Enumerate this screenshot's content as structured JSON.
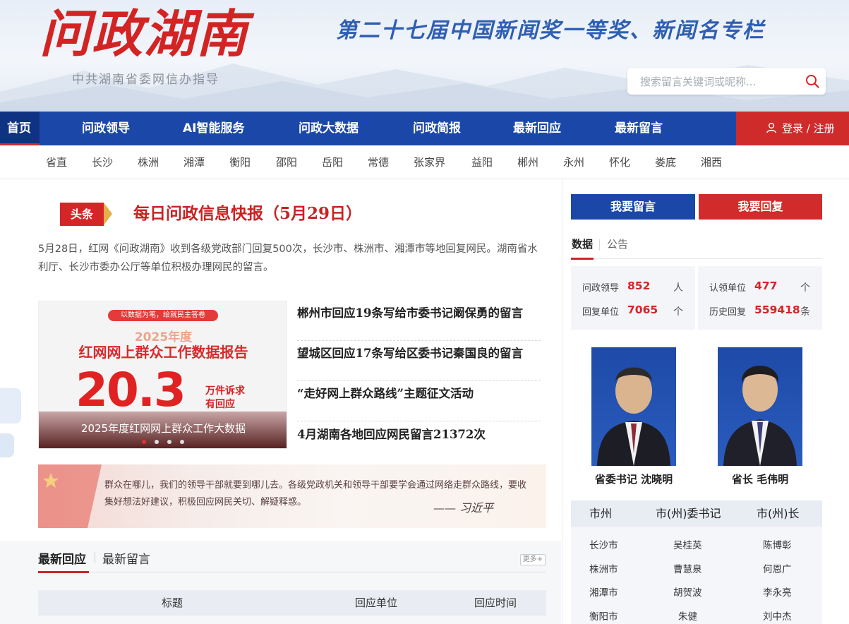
{
  "header": {
    "logo_text": "问政湖南",
    "logo_sub": "中共湖南省委网信办指导",
    "slogan": "第二十七届中国新闻奖一等奖、新闻名专栏",
    "search_placeholder": "搜索留言关键词或昵称..."
  },
  "nav": {
    "items": [
      "首页",
      "问政领导",
      "AI智能服务",
      "问政大数据",
      "问政简报",
      "最新回应",
      "最新留言"
    ],
    "login": "登录 / 注册"
  },
  "cities": [
    "省直",
    "长沙",
    "株洲",
    "湘潭",
    "衡阳",
    "邵阳",
    "岳阳",
    "常德",
    "张家界",
    "益阳",
    "郴州",
    "永州",
    "怀化",
    "娄底",
    "湘西"
  ],
  "headline": {
    "tag": "头条",
    "title": "每日问政信息快报（5月29日）",
    "summary": "5月28日，红网《问政湖南》收到各级党政部门回复500次，长沙市、株洲市、湘潭市等地回复网民。湖南省水利厅、长沙市委办公厅等单位积极办理网民的留言。"
  },
  "carousel": {
    "chip": "以数据为笔，绘就民主答卷",
    "year": "2025年度",
    "title": "红网网上群众工作数据报告",
    "number": "20.3",
    "unit1": "万件诉求",
    "unit2": "有回应",
    "caption": "2025年度红网网上群众工作大数据",
    "slide_count": 4,
    "active_slide": 1
  },
  "news": [
    "郴州市回应19条写给市委书记阚保勇的留言",
    "望城区回应17条写给区委书记秦国良的留言",
    "“走好网上群众路线”主题征文活动",
    "4月湖南各地回应网民留言21372次"
  ],
  "quote": {
    "text": "群众在哪儿，我们的领导干部就要到哪儿去。各级党政机关和领导干部要学会通过网络走群众路线，要收集好想法好建议，积极回应网民关切、解疑释惑。",
    "signature": "—— 习近平"
  },
  "tabs": {
    "items": [
      "最新回应",
      "最新留言"
    ],
    "more": "更多+",
    "columns": [
      "标题",
      "回应单位",
      "回应时间"
    ]
  },
  "right": {
    "btn_message": "我要留言",
    "btn_reply": "我要回复",
    "tabs": [
      "数据",
      "公告"
    ],
    "stats": [
      {
        "label": "问政领导",
        "value": "852",
        "unit": "人"
      },
      {
        "label": "回复单位",
        "value": "7065",
        "unit": "个"
      },
      {
        "label": "认领单位",
        "value": "477",
        "unit": "个"
      },
      {
        "label": "历史回复",
        "value": "559418",
        "unit": "条"
      }
    ],
    "leaders": [
      {
        "caption": "省委书记 沈晓明"
      },
      {
        "caption": "省长 毛伟明"
      }
    ],
    "table_headers": [
      "市州",
      "市(州)委书记",
      "市(州)长"
    ],
    "table_rows": [
      [
        "长沙市",
        "吴桂英",
        "陈博彰"
      ],
      [
        "株洲市",
        "曹慧泉",
        "何恩广"
      ],
      [
        "湘潭市",
        "胡贺波",
        "李永亮"
      ],
      [
        "衡阳市",
        "朱健",
        "刘中杰"
      ]
    ]
  },
  "colors": {
    "brand_red": "#d42626",
    "brand_blue": "#1b48a8",
    "accent_gold": "#e5b04b"
  }
}
